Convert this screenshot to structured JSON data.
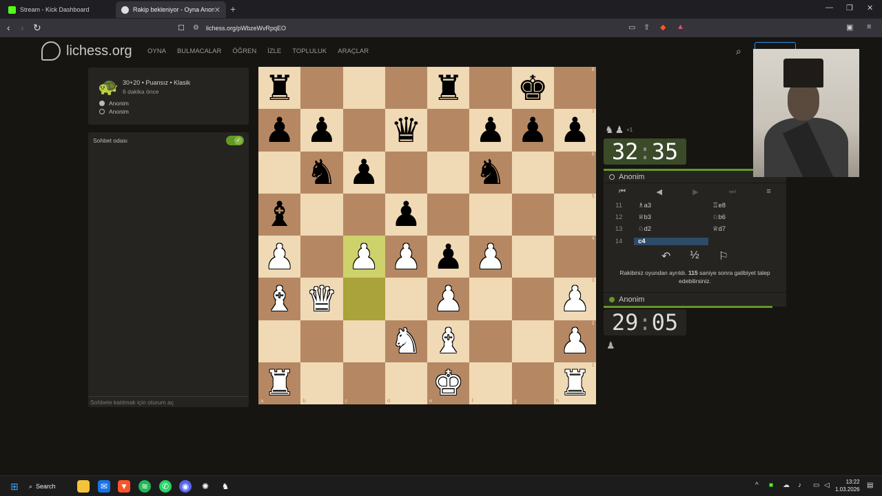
{
  "browser": {
    "tabs": [
      {
        "label": "Stream - Kick Dashboard",
        "icon_color": "#53fc18"
      },
      {
        "label": "Rakip bekleniyor - Oyna Anon",
        "icon_color": "#dddddd"
      }
    ],
    "new_tab": "+",
    "url": "lichess.org/pWbzeWvRpqEO",
    "window_controls": [
      "—",
      "❐",
      "✕"
    ]
  },
  "site": {
    "logo": "lichess.org",
    "nav": [
      "OYNA",
      "BULMACALAR",
      "ÖĞREN",
      "İZLE",
      "TOPLULUK",
      "ARAÇLAR"
    ]
  },
  "game": {
    "mode": "30+20 • Puansız • Klasik",
    "time_ago": "6 dakika önce",
    "players": [
      "Anonim",
      "Anonim"
    ]
  },
  "chat": {
    "title": "Sohbet odası",
    "placeholder": "Sohbete katılmak için oturum aç"
  },
  "board": {
    "files": [
      "a",
      "b",
      "c",
      "d",
      "e",
      "f",
      "g",
      "h"
    ],
    "ranks": [
      "8",
      "7",
      "6",
      "5",
      "4",
      "3",
      "2",
      "1"
    ],
    "squares": [
      [
        "bR",
        "",
        "",
        "",
        "bR",
        "",
        "bK",
        ""
      ],
      [
        "bP",
        "bP",
        "",
        "bQ",
        "",
        "bP",
        "bP",
        "bP"
      ],
      [
        "",
        "bN",
        "bP",
        "",
        "",
        "bN",
        "",
        ""
      ],
      [
        "bB",
        "",
        "",
        "bP",
        "",
        "",
        "",
        ""
      ],
      [
        "wP",
        "",
        "wP",
        "wP",
        "bP",
        "wP",
        "",
        ""
      ],
      [
        "wB",
        "wQ",
        "",
        "",
        "wP",
        "",
        "",
        "wP"
      ],
      [
        "",
        "",
        "",
        "wN",
        "wB",
        "",
        "",
        "wP"
      ],
      [
        "wR",
        "",
        "",
        "",
        "wK",
        "",
        "",
        "wR"
      ]
    ],
    "highlights": {
      "hl1": [
        [
          4,
          2
        ]
      ],
      "hl2": [
        [
          5,
          2
        ]
      ]
    }
  },
  "right": {
    "captured": [
      "♞",
      "♟"
    ],
    "advantage": "+1",
    "top_clock": {
      "min": "32",
      "sec": "35"
    },
    "bottom_clock": {
      "min": "29",
      "sec": "05"
    },
    "top_player": "Anonim",
    "bottom_player": "Anonim",
    "controls": [
      "⏮",
      "◀",
      "▶",
      "⏭",
      "≡"
    ],
    "moves": [
      {
        "n": "11",
        "w": "♗a3",
        "b": "♖e8"
      },
      {
        "n": "12",
        "w": "♕b3",
        "b": "♘b6"
      },
      {
        "n": "13",
        "w": "♘d2",
        "b": "♕d7"
      },
      {
        "n": "14",
        "w": "c4",
        "b": ""
      }
    ],
    "actions": [
      "↶",
      "½",
      "⚐"
    ],
    "message_pre": "Rakibiniz oyundan ayrıldı. ",
    "message_num": "115",
    "message_post": " saniye sonra galibiyet talep edebilirsiniz."
  },
  "taskbar": {
    "search": "Search",
    "time": "13:22",
    "date": "1.03.2026"
  }
}
